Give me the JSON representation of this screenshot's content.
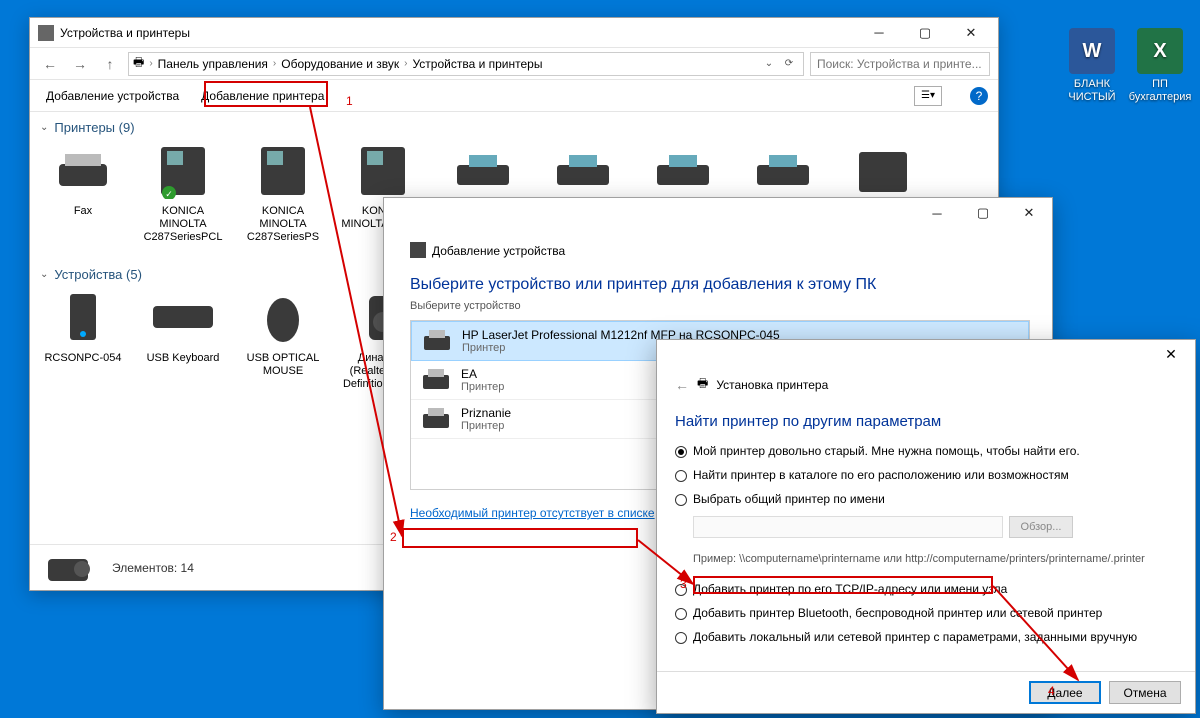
{
  "explorer": {
    "title": "Устройства и принтеры",
    "breadcrumb": {
      "root": "Панель управления",
      "mid": "Оборудование и звук",
      "leaf": "Устройства и принтеры"
    },
    "search_placeholder": "Поиск: Устройства и принте...",
    "toolbar": {
      "add_device": "Добавление устройства",
      "add_printer": "Добавление принтера"
    },
    "sections": {
      "printers": {
        "header": "Принтеры (9)",
        "items": [
          "Fax",
          "KONICA MINOLTA C287SeriesPCL",
          "KONICA MINOLTA C287SeriesPS",
          "KONICA MINOLTA C287S"
        ]
      },
      "devices": {
        "header": "Устройства (5)",
        "items": [
          "RCSONPC-054",
          "USB Keyboard",
          "USB OPTICAL MOUSE",
          "Динамики (Realtek High Definition Audio)"
        ]
      }
    },
    "status": "Элементов: 14"
  },
  "dialog1": {
    "title": "Добавление устройства",
    "heading": "Выберите устройство или принтер для добавления к этому ПК",
    "subheading": "Выберите устройство",
    "devices": [
      {
        "name": "HP LaserJet Professional M1212nf MFP на RCSONPC-045",
        "type": "Принтер"
      },
      {
        "name": "EA",
        "type": "Принтер"
      },
      {
        "name": "Priznanie",
        "type": "Принтер"
      }
    ],
    "missing_link": "Необходимый принтер отсутствует в списке"
  },
  "dialog2": {
    "title": "Установка принтера",
    "heading": "Найти принтер по другим параметрам",
    "options": [
      "Мой принтер довольно старый. Мне нужна помощь, чтобы найти его.",
      "Найти принтер в каталоге по его расположению или возможностям",
      "Выбрать общий принтер по имени",
      "Добавить принтер по его TCP/IP-адресу или имени узла",
      "Добавить принтер Bluetooth, беспроводной принтер или сетевой принтер",
      "Добавить локальный или сетевой принтер с параметрами, заданными вручную"
    ],
    "example": "Пример: \\\\computername\\printername или http://computername/printers/printername/.printer",
    "browse": "Обзор...",
    "next": "Далее",
    "cancel": "Отмена"
  },
  "desktop": [
    {
      "label1": "БЛАНК",
      "label2": "ЧИСТЫЙ"
    },
    {
      "label1": "ПП",
      "label2": "бухгалтерия"
    }
  ],
  "annot": {
    "n1": "1",
    "n2": "2",
    "n3": "3",
    "n4": "4"
  }
}
